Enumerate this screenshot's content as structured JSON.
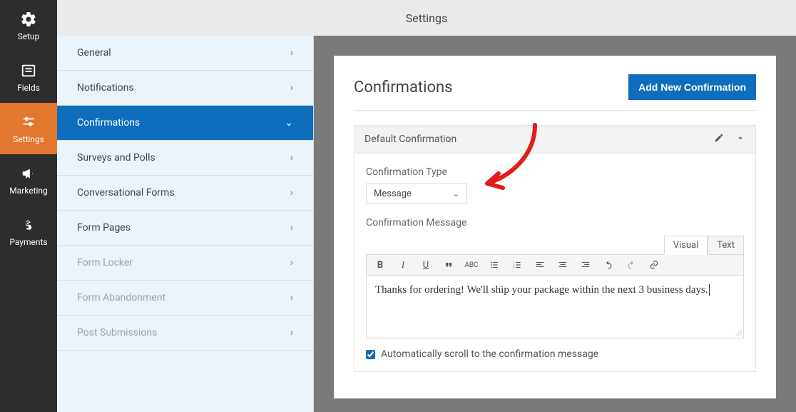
{
  "topbar": {
    "title": "Settings"
  },
  "rail": {
    "items": [
      {
        "key": "setup",
        "label": "Setup"
      },
      {
        "key": "fields",
        "label": "Fields"
      },
      {
        "key": "settings",
        "label": "Settings"
      },
      {
        "key": "marketing",
        "label": "Marketing"
      },
      {
        "key": "payments",
        "label": "Payments"
      }
    ]
  },
  "settings_nav": {
    "items": [
      {
        "label": "General"
      },
      {
        "label": "Notifications"
      },
      {
        "label": "Confirmations"
      },
      {
        "label": "Surveys and Polls"
      },
      {
        "label": "Conversational Forms"
      },
      {
        "label": "Form Pages"
      },
      {
        "label": "Form Locker"
      },
      {
        "label": "Form Abandonment"
      },
      {
        "label": "Post Submissions"
      }
    ]
  },
  "panel": {
    "title": "Confirmations",
    "add_button": "Add New Confirmation"
  },
  "confirmation": {
    "name": "Default Confirmation",
    "type_label": "Confirmation Type",
    "type_value": "Message",
    "message_label": "Confirmation Message",
    "editor_tabs": {
      "visual": "Visual",
      "text": "Text"
    },
    "message_value": "Thanks for ordering! We'll ship your package within the next 3 business days.",
    "auto_scroll_label": "Automatically scroll to the confirmation message",
    "auto_scroll_checked": true
  }
}
